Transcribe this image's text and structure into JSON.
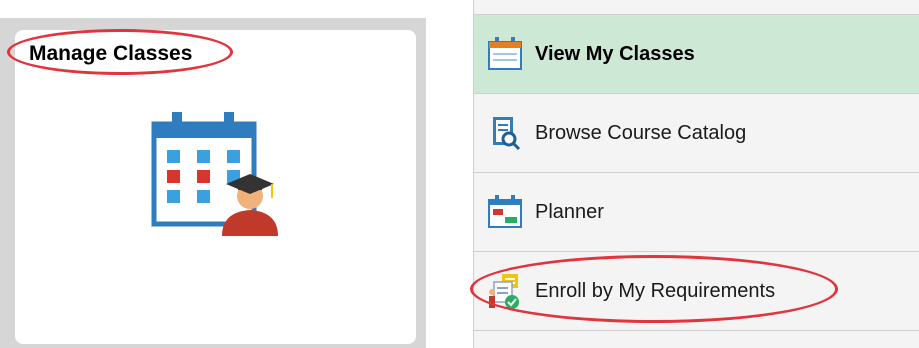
{
  "tile": {
    "title": "Manage Classes",
    "icon": "calendar-graduate-icon"
  },
  "menu": {
    "items": [
      {
        "label": "View My Classes",
        "icon": "calendar-icon",
        "active": true
      },
      {
        "label": "Browse Course Catalog",
        "icon": "catalog-search-icon",
        "active": false
      },
      {
        "label": "Planner",
        "icon": "planner-calendar-icon",
        "active": false
      },
      {
        "label": "Enroll by My Requirements",
        "icon": "requirements-check-icon",
        "active": false
      }
    ]
  },
  "colors": {
    "active_item_bg": "#cde8d5",
    "highlight_oval": "#e2343c",
    "calendar_blue": "#2f7dbf",
    "calendar_red": "#d9352f",
    "grad_cap": "#333333",
    "gown_red": "#c0392b"
  }
}
